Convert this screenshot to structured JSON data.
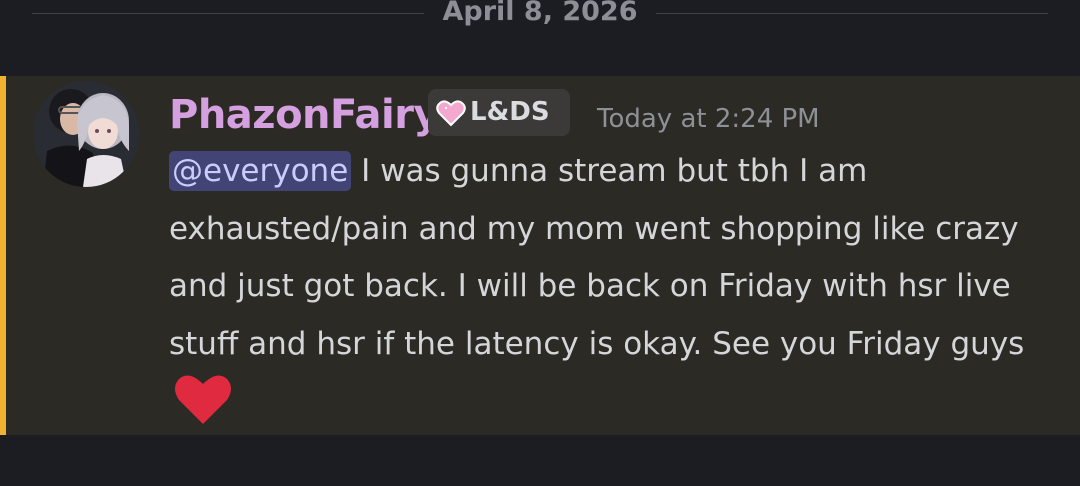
{
  "date_divider": {
    "label": "April 8, 2026"
  },
  "message": {
    "author": {
      "username": "PhazonFairy",
      "username_color": "#d5a0e0",
      "role_tag": {
        "icon": "pink-heart-icon",
        "label": "L&DS"
      },
      "avatar": "user-avatar"
    },
    "timestamp": "Today at 2:24 PM",
    "mention": "@everyone",
    "body": " I was gunna stream but tbh I am exhausted/pain and my mom went shopping like crazy and just got back. I will be back on Friday with hsr live stuff  and hsr if the latency is okay. See you Friday guys",
    "trailing_emoji": "red-heart-icon",
    "highlight_color": "#f0b232"
  }
}
